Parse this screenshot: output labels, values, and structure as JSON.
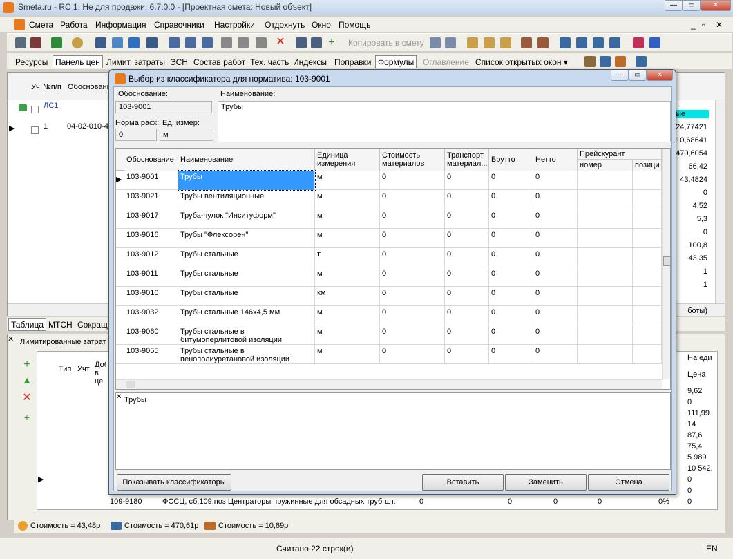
{
  "window": {
    "title": "Smeta.ru - RC 1. Не для продажи.  6.7.0.0   - [Проектная смета: Новый объект]"
  },
  "menu": [
    "Смета",
    "Работа",
    "Информация",
    "Справочники",
    "Настройки",
    "Отдохнуть",
    "Окно",
    "Помощь"
  ],
  "toolbar": {
    "copy_label": "Копировать в смету"
  },
  "tabs": [
    "Ресурсы",
    "Панель цен",
    "Лимит. затраты",
    "ЭСН",
    "Состав работ",
    "Тех. часть",
    "Индексы",
    "Поправки",
    "Формулы",
    "Оглавление",
    "Список открытых окон ▾"
  ],
  "left_grid": {
    "headers": [
      "Уч",
      "№п/п",
      "Обоснование"
    ],
    "rows": [
      {
        "num": "ЛС1",
        "code": ""
      },
      {
        "num": "1",
        "code": "04-02-010-4"
      }
    ]
  },
  "right_values": [
    "ые",
    "24,77421",
    "10,68641",
    "470,6054",
    "66,42",
    "43,4824",
    "0",
    "4,52",
    "5,3",
    "0",
    "100,8",
    "43,35",
    "1",
    "1",
    "боты)"
  ],
  "bottom_tabs": [
    "Таблица",
    "МТСН",
    "Сокраще"
  ],
  "lower_panel": {
    "title": "Лимитированные затрат",
    "headers": [
      "Тип",
      "Учт",
      "Доб в це"
    ],
    "right_headers": [
      "На еди",
      "Цена"
    ],
    "prices": [
      "9,62",
      "0",
      "111,99",
      "14",
      "87,6",
      "75,4",
      "5 989",
      "10 542,",
      "0",
      "0",
      "0"
    ],
    "last_row": {
      "code": "109-9180",
      "name": "ФССЦ, сб.109,поз Центраторы пружинные для обсадных труб",
      "unit": "шт.",
      "v1": "0",
      "v2": "0",
      "v3": "0",
      "v4": "0",
      "pct": "0%",
      "price": "0"
    }
  },
  "status_costs": [
    "Стоимость = 43,48р",
    "Стоимость = 470,61р",
    "Стоимость = 10,69р"
  ],
  "status_text": "Считано 22 строк(и)",
  "lang": "EN",
  "dialog": {
    "title": "Выбор из классификатора для норматива: 103-9001",
    "obosn_label": "Обоснование:",
    "obosn_value": "103-9001",
    "name_label": "Наименование:",
    "name_value": "Трубы",
    "norma_label": "Норма расх:",
    "norma_value": "0",
    "unit_label": "Ед. измер:",
    "unit_value": "м",
    "columns": [
      "Обоснование",
      "Наименование",
      "Единица измерения",
      "Стоимость материалов",
      "Транспорт материал...",
      "Брутто",
      "Нетто",
      "Прейскурант"
    ],
    "subcolumns": [
      "номер",
      "позици"
    ],
    "rows": [
      {
        "code": "103-9001",
        "name": "Трубы",
        "unit": "м",
        "cost": "0",
        "trans": "0",
        "brutto": "0",
        "netto": "0"
      },
      {
        "code": "103-9021",
        "name": "Трубы вентиляционные",
        "unit": "м",
        "cost": "0",
        "trans": "0",
        "brutto": "0",
        "netto": "0"
      },
      {
        "code": "103-9017",
        "name": "Труба-чулок \"Инситуформ\"",
        "unit": "м",
        "cost": "0",
        "trans": "0",
        "brutto": "0",
        "netto": "0"
      },
      {
        "code": "103-9016",
        "name": "Трубы \"Флексорен\"",
        "unit": "м",
        "cost": "0",
        "trans": "0",
        "brutto": "0",
        "netto": "0"
      },
      {
        "code": "103-9012",
        "name": "Трубы стальные",
        "unit": "т",
        "cost": "0",
        "trans": "0",
        "brutto": "0",
        "netto": "0"
      },
      {
        "code": "103-9011",
        "name": "Трубы стальные",
        "unit": "м",
        "cost": "0",
        "trans": "0",
        "brutto": "0",
        "netto": "0"
      },
      {
        "code": "103-9010",
        "name": "Трубы стальные",
        "unit": "км",
        "cost": "0",
        "trans": "0",
        "brutto": "0",
        "netto": "0"
      },
      {
        "code": "103-9032",
        "name": "Трубы стальные 146х4,5 мм",
        "unit": "м",
        "cost": "0",
        "trans": "0",
        "brutto": "0",
        "netto": "0"
      },
      {
        "code": "103-9060",
        "name": "Трубы стальные в битумоперлитовой изоляции",
        "unit": "м",
        "cost": "0",
        "trans": "0",
        "brutto": "0",
        "netto": "0"
      },
      {
        "code": "103-9055",
        "name": "Трубы стальные в пенополиуретановой изоляции",
        "unit": "м",
        "cost": "0",
        "trans": "0",
        "brutto": "0",
        "netto": "0"
      }
    ],
    "memo": "Трубы",
    "btn_show": "Показывать классификаторы",
    "btn_insert": "Вставить",
    "btn_replace": "Заменить",
    "btn_cancel": "Отмена"
  }
}
